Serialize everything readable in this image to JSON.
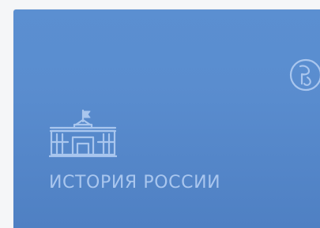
{
  "card": {
    "title": "ИСТОРИЯ РОССИИ",
    "icon": "government-building-icon",
    "logo": "rf-monogram-logo",
    "colors": {
      "background_top": "#5b8fd1",
      "background_bottom": "#4f80c3",
      "foreground": "#a9c6ee"
    }
  }
}
